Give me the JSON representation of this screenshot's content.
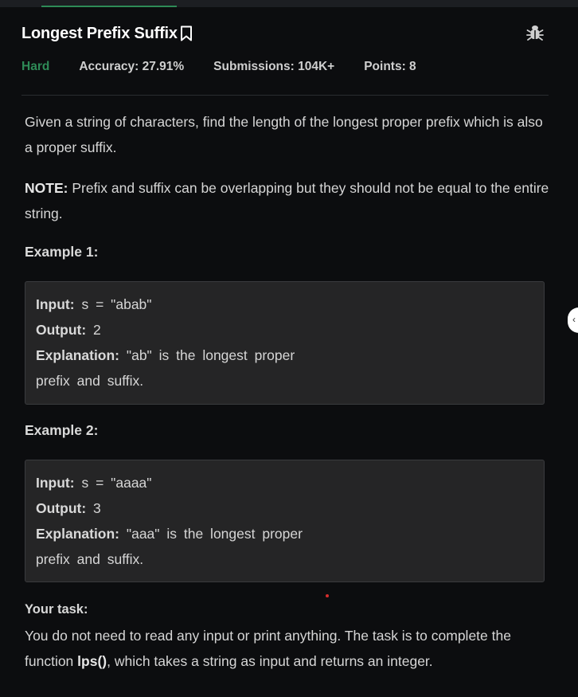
{
  "problem": {
    "title": "Longest Prefix Suffix",
    "difficulty": "Hard",
    "accuracy": "Accuracy: 27.91%",
    "submissions": "Submissions: 104K+",
    "points": "Points: 8"
  },
  "description": {
    "para1": "Given a string of characters, find the length of the longest proper prefix which is also a proper suffix.",
    "note_label": "NOTE:",
    "note_text": " Prefix and suffix can be overlapping but they should not be equal to the entire string."
  },
  "examples": [
    {
      "heading": "Example 1:",
      "input_label": "Input:",
      "input_value": " s = \"abab\"",
      "output_label": "Output:",
      "output_value": " 2",
      "explanation_label": "Explanation:",
      "explanation_line1": " \"ab\" is the longest proper",
      "explanation_line2": "prefix and suffix."
    },
    {
      "heading": "Example 2:",
      "input_label": "Input:",
      "input_value": " s = \"aaaa\"",
      "output_label": "Output:",
      "output_value": " 3",
      "explanation_label": "Explanation:",
      "explanation_line1": " \"aaa\" is the longest proper",
      "explanation_line2": "prefix and suffix."
    }
  ],
  "task": {
    "heading": "Your task:",
    "text_before": "You do not need to read any input or print anything. The task is to complete the function ",
    "function_name": "lps()",
    "text_after": ", which takes a string as input and returns an integer."
  },
  "icons": {
    "bookmark": "bookmark-icon",
    "bug": "bug-report-icon",
    "collapse": "chevron-left-icon"
  },
  "colors": {
    "background": "#0c0d0f",
    "difficulty_hard": "#2e8b57",
    "example_box": "#252526",
    "accent_tab": "#2e8b57"
  }
}
